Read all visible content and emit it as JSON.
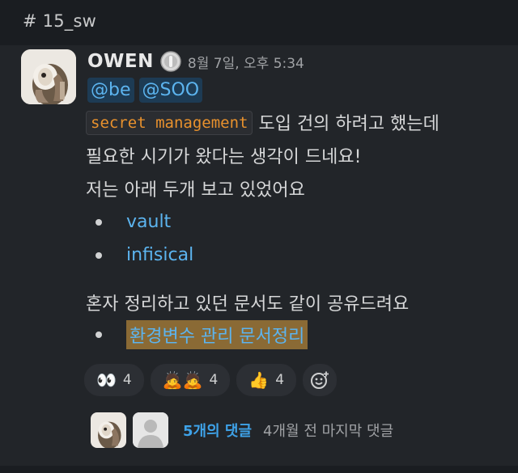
{
  "channel": {
    "name": "# 15_sw"
  },
  "message": {
    "author": "OWEN",
    "status_icon": "badge-icon",
    "timestamp": "8월 7일, 오후 5:34",
    "mentions": [
      "@be",
      "@SOO"
    ],
    "lines": {
      "line1_code": "secret management",
      "line1_text": "도입 건의 하려고 했는데",
      "line2": "필요한 시기가 왔다는 생각이 드네요!",
      "line3": "저는 아래 두개 보고 있었어요",
      "line4": "혼자 정리하고 있던 문서도 같이 공유드려요"
    },
    "links": [
      "vault",
      "infisical"
    ],
    "doc_link": "환경변수 관리 문서정리"
  },
  "reactions": [
    {
      "emoji": "👀",
      "count": "4"
    },
    {
      "emoji": "🙇🙇",
      "count": "4"
    },
    {
      "emoji": "👍",
      "count": "4"
    }
  ],
  "thread": {
    "reply_count": "5개의 댓글",
    "last_reply": "4개월 전 마지막 댓글"
  },
  "colors": {
    "background": "#1a1d21",
    "link": "#5cb4ef",
    "code": "#e8912d",
    "highlight": "#8a6a35"
  }
}
